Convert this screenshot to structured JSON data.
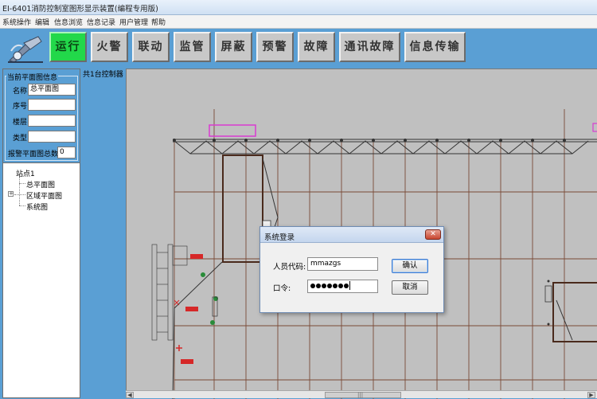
{
  "window": {
    "title": "EI-6401消防控制室图形显示装置(编程专用版)"
  },
  "menu": {
    "items": [
      {
        "label": "系统操作"
      },
      {
        "label": "编辑"
      },
      {
        "label": "信息浏览"
      },
      {
        "label": "信息记录"
      },
      {
        "label": "用户管理"
      },
      {
        "label": "帮助"
      }
    ]
  },
  "toolbar": {
    "buttons": [
      {
        "label": "运行",
        "active": true
      },
      {
        "label": "火警"
      },
      {
        "label": "联动"
      },
      {
        "label": "监管"
      },
      {
        "label": "屏蔽"
      },
      {
        "label": "预警"
      },
      {
        "label": "故障"
      },
      {
        "label": "通讯故障"
      },
      {
        "label": "信息传输"
      }
    ],
    "active_color": "#22d84a"
  },
  "plan_info": {
    "legend": "当前平面图信息",
    "name_label": "名称",
    "name_value": "总平面图",
    "seq_label": "序号",
    "seq_value": "",
    "floor_label": "楼层",
    "floor_value": "",
    "type_label": "类型",
    "type_value": "",
    "alarm_label": "报警平面图总数",
    "alarm_value": "0"
  },
  "tree": {
    "root": "站点1",
    "children": [
      {
        "label": "总平面图",
        "expandable": false
      },
      {
        "label": "区域平面图",
        "expandable": true,
        "expander": "+"
      },
      {
        "label": "系统图",
        "expandable": false
      }
    ]
  },
  "controller_count_label": "共1台控制器",
  "login_dialog": {
    "title": "系统登录",
    "close_symbol": "✕",
    "user_label": "人员代码:",
    "user_value": "mmazgs",
    "password_label": "口令:",
    "password_mask_count": 7,
    "confirm_label": "确认",
    "cancel_label": "取消"
  },
  "scrollbar": {
    "left_arrow": "◀",
    "right_arrow": "▶",
    "grip": "|||"
  },
  "colors": {
    "background_blue": "#5a9fd4",
    "canvas_gray": "#c0c0c0",
    "selection_magenta": "#d93bd1",
    "device_red": "#cc2222",
    "grid_brown": "#7a4a36"
  }
}
